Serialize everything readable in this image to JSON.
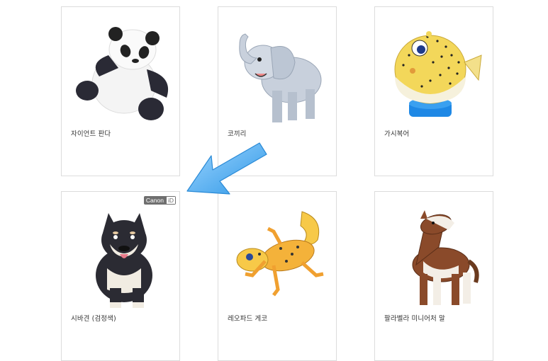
{
  "products": [
    {
      "name": "자이언트 판다",
      "icon": "panda-icon"
    },
    {
      "name": "코끼리",
      "icon": "elephant-icon"
    },
    {
      "name": "가시복어",
      "icon": "porcupinefish-icon"
    },
    {
      "name": "시바견 (검정색)",
      "icon": "shiba-dog-icon",
      "badge": {
        "brand": "Canon",
        "suffix": "iD"
      }
    },
    {
      "name": "레오파드 게코",
      "icon": "gecko-icon"
    },
    {
      "name": "팔라벨라 미니어처 말",
      "icon": "horse-icon"
    }
  ],
  "colors": {
    "arrow": "#3aa6ec",
    "card_border": "#dcdcdc",
    "text": "#333333"
  }
}
